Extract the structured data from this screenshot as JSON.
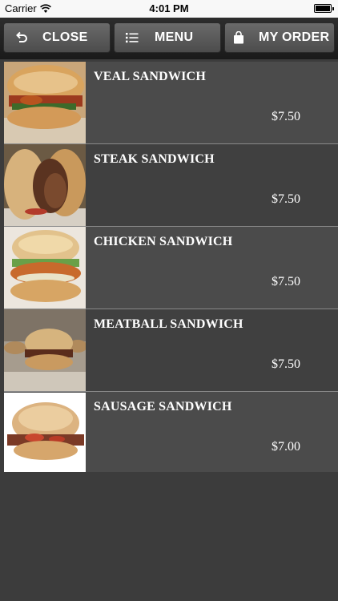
{
  "status_bar": {
    "carrier": "Carrier",
    "time": "4:01 PM",
    "wifi_icon": "wifi-icon",
    "battery_icon": "battery-icon"
  },
  "toolbar": {
    "close_label": "CLOSE",
    "close_icon": "return-arrow-icon",
    "menu_label": "MENU",
    "menu_icon": "list-icon",
    "order_label": "MY ORDER",
    "order_icon": "shopping-bag-icon"
  },
  "colors": {
    "background": "#3c3c3c",
    "row_light": "#4b4b4b",
    "row_dark": "#404040",
    "button": "#5a5a5a"
  },
  "items": [
    {
      "name": "VEAL SANDWICH",
      "price": "$7.50",
      "image": "veal-sandwich-photo"
    },
    {
      "name": "STEAK SANDWICH",
      "price": "$7.50",
      "image": "steak-sandwich-photo"
    },
    {
      "name": "CHICKEN SANDWICH",
      "price": "$7.50",
      "image": "chicken-sandwich-photo"
    },
    {
      "name": "MEATBALL SANDWICH",
      "price": "$7.50",
      "image": "meatball-sandwich-photo"
    },
    {
      "name": "SAUSAGE SANDWICH",
      "price": "$7.00",
      "image": "sausage-sandwich-photo"
    }
  ]
}
